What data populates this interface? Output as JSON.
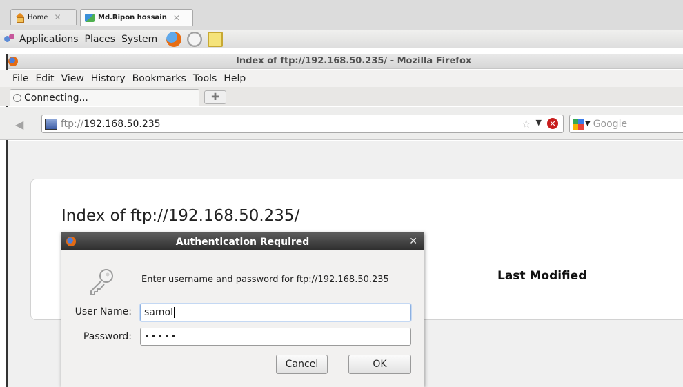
{
  "vnc_tabs": [
    {
      "label": "Home",
      "icon": "home-icon"
    },
    {
      "label": "Md.Ripon hossain",
      "icon": "network-icon"
    }
  ],
  "gnome_panel": {
    "menus": [
      "Applications",
      "Places",
      "System"
    ]
  },
  "firefox": {
    "window_title": "Index of ftp://192.168.50.235/ - Mozilla Firefox",
    "menu": [
      "File",
      "Edit",
      "View",
      "History",
      "Bookmarks",
      "Tools",
      "Help"
    ],
    "tab_label": "Connecting...",
    "url_proto": "ftp://",
    "url_host": "192.168.50.235",
    "search_placeholder": "Google"
  },
  "page": {
    "heading": "Index of ftp://192.168.50.235/",
    "column_last_modified": "Last Modified"
  },
  "auth_dialog": {
    "title": "Authentication Required",
    "message": "Enter username and password for ftp://192.168.50.235",
    "username_label": "User Name:",
    "username_value": "samol",
    "password_label": "Password:",
    "password_mask": "•••••",
    "cancel_label": "Cancel",
    "ok_label": "OK"
  }
}
